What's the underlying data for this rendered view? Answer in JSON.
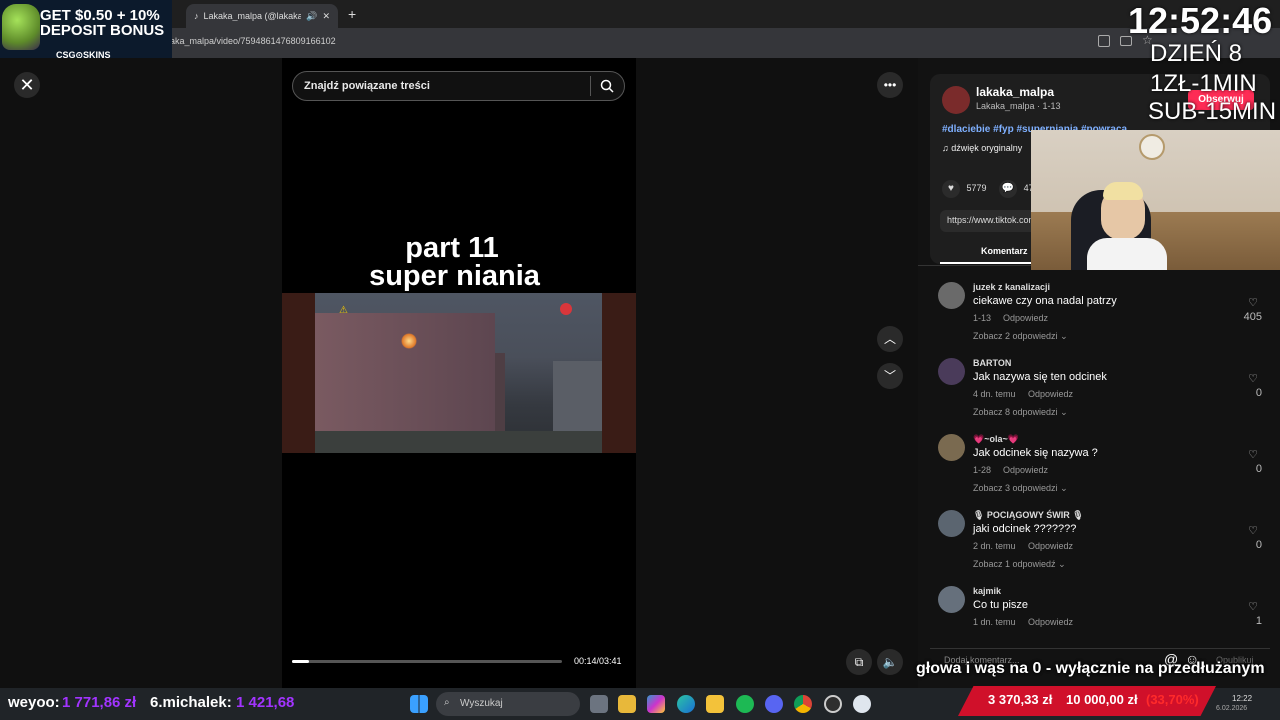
{
  "browser": {
    "tab_title": "Lakaka_malpa (@lakaka_m",
    "new_tab": "+",
    "url": "aka_malpa/video/7594861476809166102"
  },
  "promo": {
    "line1": "GET $0.50 + 10%",
    "line2": "DEPOSIT BONUS",
    "brand": "CSG⊙SKINS"
  },
  "video": {
    "search_placeholder": "Znajdź powiązane treści",
    "caption_line1": "part 11",
    "caption_line2": "super niania",
    "time": "00:14/03:41",
    "progress": 0.063
  },
  "author": {
    "name": "lakaka_malpa",
    "sub": "Lakaka_malpa · 1-13",
    "follow_label": "Obserwuj",
    "tags": "#dlaciebie #fyp #superniania #powraca",
    "sound": "♫  dźwięk oryginalny",
    "likes": "5779",
    "comments_count": "47",
    "link": "https://www.tiktok.com/@lakaka_malpa",
    "tab_label": "Komentarz"
  },
  "comments": [
    {
      "user": "juzek z kanalizacji",
      "text": "ciekawe czy ona nadal patrzy",
      "meta": "1-13",
      "reply": "Odpowiedz",
      "more": "Zobacz 2 odpowiedzi",
      "likes": "405"
    },
    {
      "user": "BARTON",
      "text": "Jak nazywa się ten odcinek",
      "meta": "4 dn. temu",
      "reply": "Odpowiedz",
      "more": "Zobacz 8 odpowiedzi",
      "likes": "0"
    },
    {
      "user": "💗~ola~💗",
      "text": "Jak odcinek się nazywa ?",
      "meta": "1-28",
      "reply": "Odpowiedz",
      "more": "Zobacz 3 odpowiedzi",
      "likes": "0"
    },
    {
      "user": "🎙 POCIĄGOWY ŚWIR 🎙",
      "text": "jaki odcinek ???????",
      "meta": "2 dn. temu",
      "reply": "Odpowiedz",
      "more": "Zobacz 1 odpowiedź",
      "likes": "0"
    },
    {
      "user": "kajmik",
      "text": "Co tu pisze",
      "meta": "1 dn. temu",
      "reply": "Odpowiedz",
      "more": "",
      "likes": "1"
    }
  ],
  "comment_input": {
    "placeholder": "Dodaj komentarz...",
    "publish": "Opublikuj"
  },
  "overlay": {
    "clock": "12:52:46",
    "day": "DZIEŃ 8",
    "rate1": "1ZŁ-1MIN",
    "rate2": "SUB-15MIN",
    "ticker": "głowa i wąs na 0 - wyłącznie na przedłużanym"
  },
  "bottom": {
    "donor1_name": "weyoo:",
    "donor1_amount": "1 771,86 zł",
    "donor2_name": "6.michalek:",
    "donor2_amount": "1 421,68",
    "search": "Wyszukaj",
    "goal_current": "3 370,33 zł",
    "goal_target": "10 000,00 zł",
    "goal_pct": "(33,70%)",
    "sys_time": "12:22",
    "sys_date": "6.02.2026"
  },
  "colors": {
    "follow": "#fe2c55",
    "donor_amount": "#a234ff",
    "goal_bar": "#d0102a"
  }
}
